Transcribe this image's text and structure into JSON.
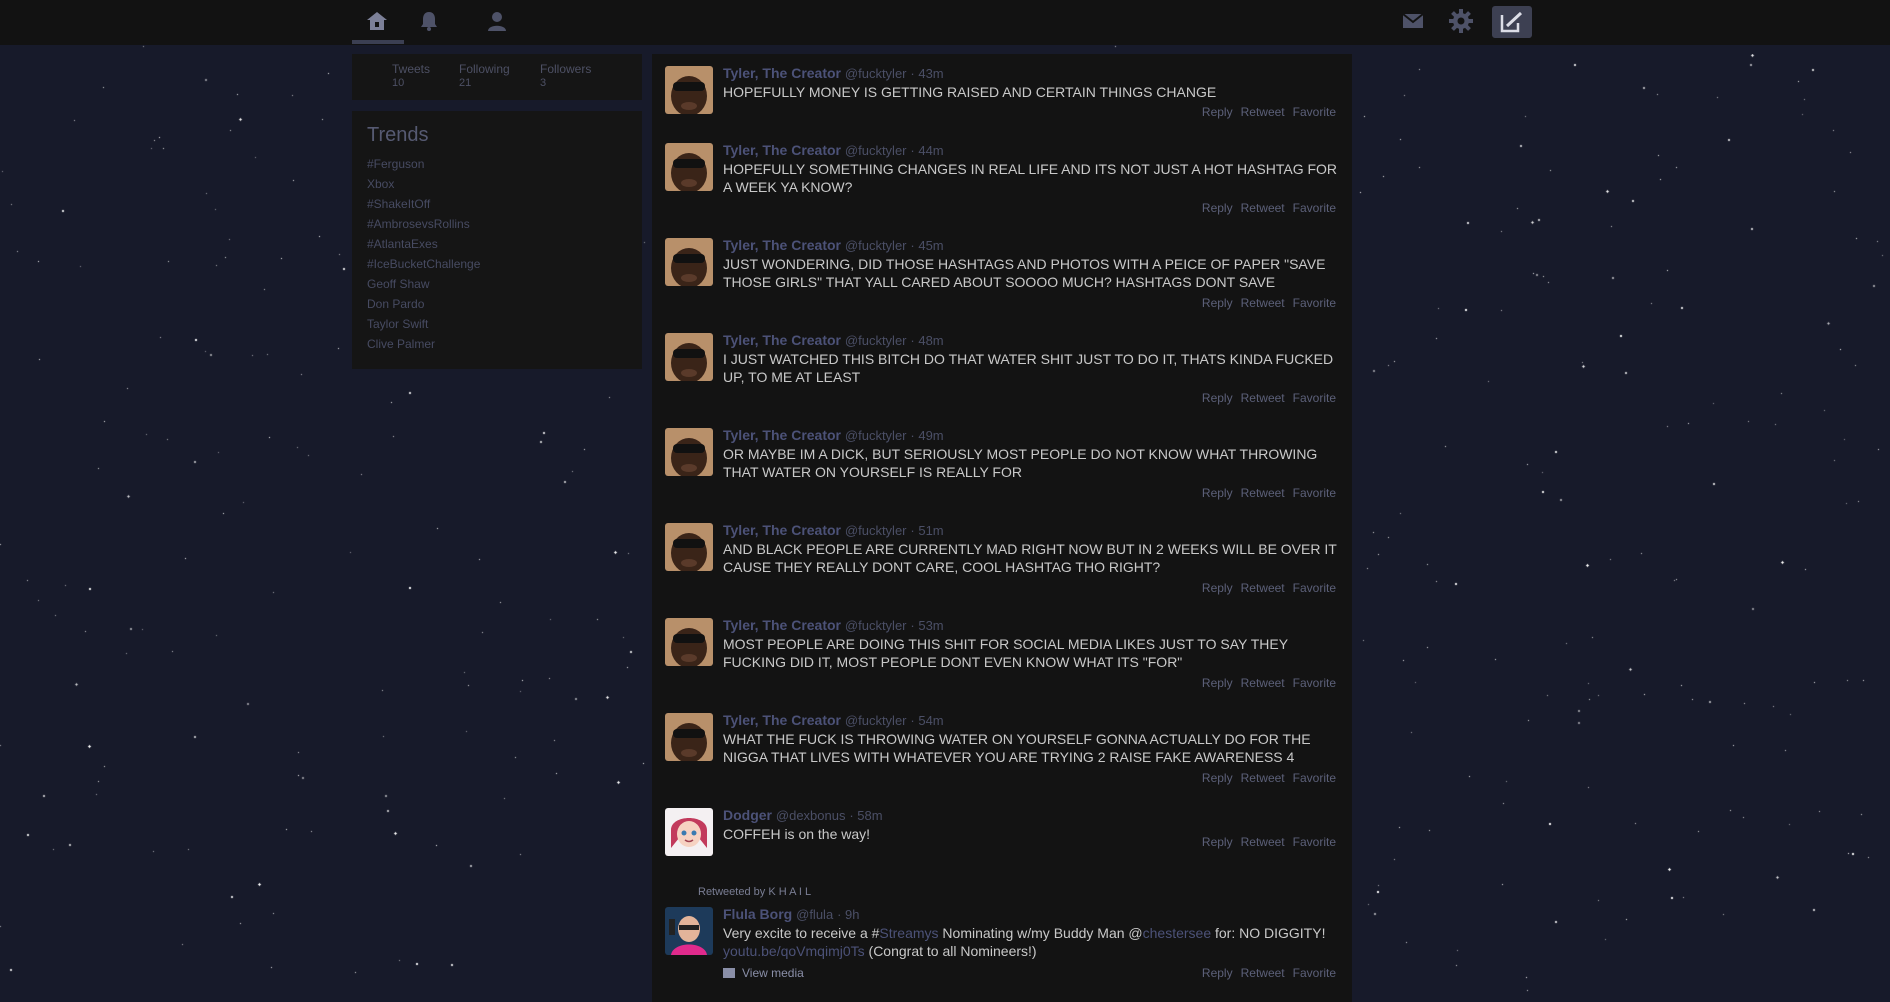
{
  "colors": {
    "background": "#171a2a",
    "topbar": "#121212",
    "panel": "#151515",
    "timeline": "#131313",
    "name_link": "#4c5278",
    "tweet_text": "#c9c9c9",
    "star": "#ffffff"
  },
  "nav": {
    "icons": [
      "home-icon",
      "bell-icon",
      "person-icon"
    ],
    "right_icons": [
      "envelope-icon",
      "gear-icon",
      "compose-icon"
    ]
  },
  "stats": [
    {
      "label": "Tweets",
      "value": "10"
    },
    {
      "label": "Following",
      "value": "21"
    },
    {
      "label": "Followers",
      "value": "3"
    }
  ],
  "trends": {
    "title": "Trends",
    "items": [
      "#Ferguson",
      "Xbox",
      "#ShakeItOff",
      "#AmbrosevsRollins",
      "#AtlantaExes",
      "#IceBucketChallenge",
      "Geoff Shaw",
      "Don Pardo",
      "Taylor Swift",
      "Clive Palmer"
    ]
  },
  "actions": {
    "reply": "Reply",
    "retweet": "Retweet",
    "favorite": "Favorite"
  },
  "tweets": [
    {
      "name": "Tyler, The Creator",
      "handle": "@fucktyler",
      "time": "· 43m",
      "text": "HOPEFULLY MONEY IS GETTING RAISED AND CERTAIN THINGS CHANGE"
    },
    {
      "name": "Tyler, The Creator",
      "handle": "@fucktyler",
      "time": "· 44m",
      "text": "HOPEFULLY SOMETHING CHANGES IN REAL LIFE AND ITS NOT JUST A HOT HASHTAG FOR A WEEK YA KNOW?"
    },
    {
      "name": "Tyler, The Creator",
      "handle": "@fucktyler",
      "time": "· 45m",
      "text": "JUST WONDERING, DID THOSE HASHTAGS AND PHOTOS WITH A PEICE OF PAPER \"SAVE THOSE GIRLS\" THAT YALL CARED ABOUT SOOOO MUCH? HASHTAGS DONT SAVE"
    },
    {
      "name": "Tyler, The Creator",
      "handle": "@fucktyler",
      "time": "· 48m",
      "text": "I JUST WATCHED THIS BITCH DO THAT WATER SHIT JUST TO DO IT, THATS KINDA FUCKED UP, TO ME AT LEAST"
    },
    {
      "name": "Tyler, The Creator",
      "handle": "@fucktyler",
      "time": "· 49m",
      "text": "OR MAYBE IM A DICK, BUT SERIOUSLY MOST PEOPLE DO NOT KNOW WHAT THROWING THAT WATER ON YOURSELF IS REALLY FOR"
    },
    {
      "name": "Tyler, The Creator",
      "handle": "@fucktyler",
      "time": "· 51m",
      "text": "AND BLACK PEOPLE ARE CURRENTLY MAD RIGHT NOW BUT IN 2 WEEKS WILL BE OVER IT CAUSE THEY REALLY DONT CARE, COOL HASHTAG THO RIGHT?"
    },
    {
      "name": "Tyler, The Creator",
      "handle": "@fucktyler",
      "time": "· 53m",
      "text": "MOST PEOPLE ARE DOING THIS SHIT FOR SOCIAL MEDIA LIKES JUST TO SAY THEY FUCKING DID IT, MOST PEOPLE DONT EVEN KNOW WHAT ITS \"FOR\""
    },
    {
      "name": "Tyler, The Creator",
      "handle": "@fucktyler",
      "time": "· 54m",
      "text": "WHAT THE FUCK IS THROWING WATER ON YOURSELF GONNA ACTUALLY DO FOR THE NIGGA THAT LIVES WITH WHATEVER YOU ARE TRYING 2 RAISE FAKE AWARENESS 4"
    },
    {
      "name": "Dodger",
      "handle": "@dexbonus",
      "time": "· 58m",
      "text": "COFFEH is on the way!"
    }
  ],
  "retweet": {
    "retweeted_by": "Retweeted by K H A I L",
    "name": "Flula Borg",
    "handle": "@flula",
    "time": "· 9h",
    "text_1": "Very excite to receive a #",
    "hashtag": "Streamys",
    "text_2": " Nominating w/my Buddy Man @",
    "mention": "chestersee",
    "text_3": " for: NO DIGGITY!",
    "url": "youtu.be/qoVmqimj0Ts",
    "text_4": " (Congrat to all Nomineers!)",
    "view_media": "View media"
  }
}
